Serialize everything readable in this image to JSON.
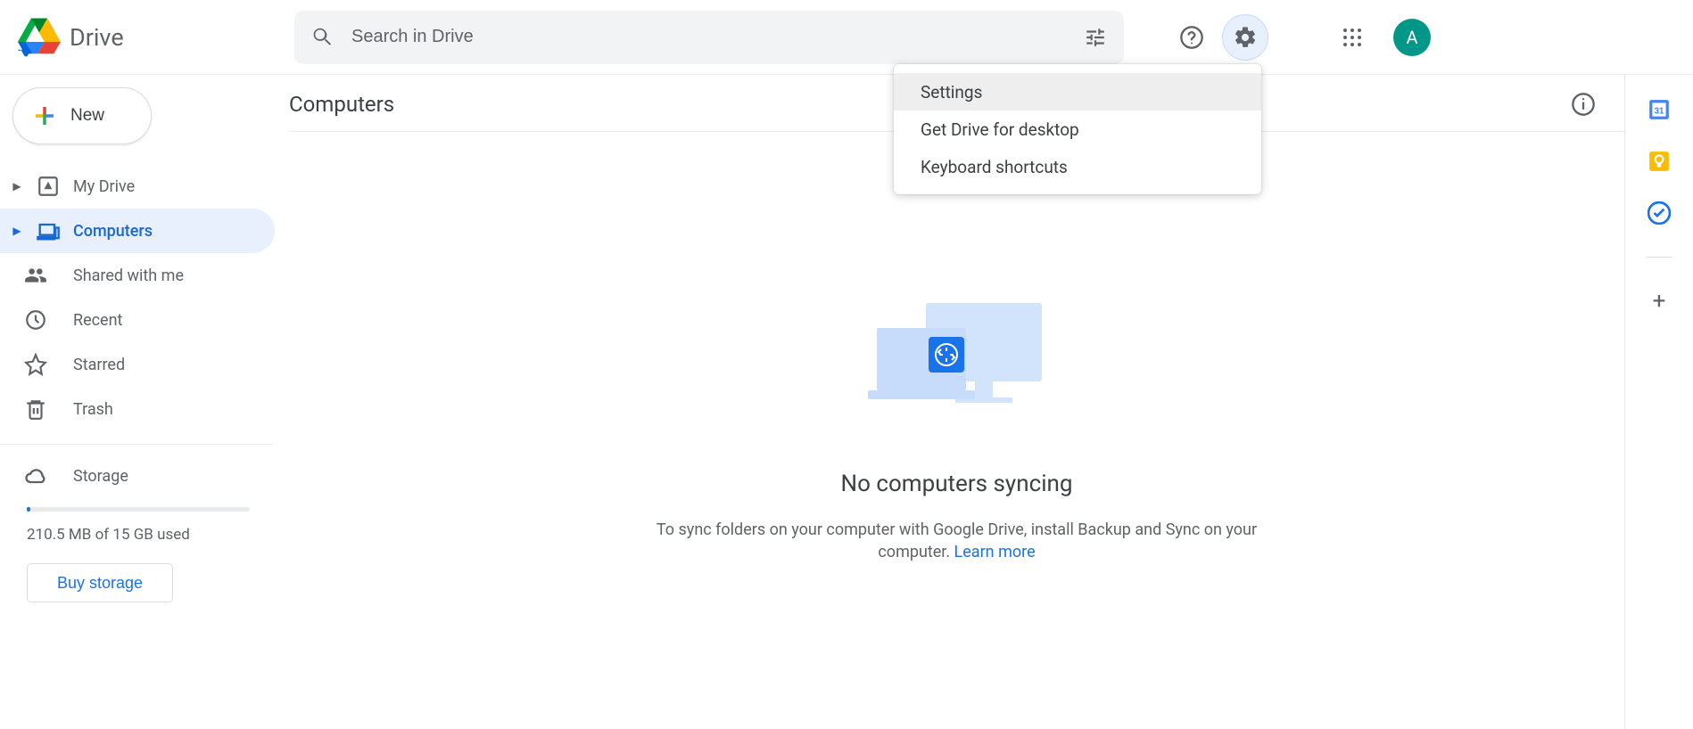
{
  "header": {
    "product_name": "Drive",
    "search_placeholder": "Search in Drive",
    "avatar_initial": "A"
  },
  "sidebar": {
    "new_label": "New",
    "items": [
      {
        "label": "My Drive"
      },
      {
        "label": "Computers"
      },
      {
        "label": "Shared with me"
      },
      {
        "label": "Recent"
      },
      {
        "label": "Starred"
      },
      {
        "label": "Trash"
      }
    ],
    "storage_label": "Storage",
    "storage_usage": "210.5 MB of 15 GB used",
    "buy_storage_label": "Buy storage"
  },
  "main": {
    "title": "Computers",
    "empty_title": "No computers syncing",
    "empty_desc_1": "To sync folders on your computer with Google Drive, install Backup and Sync on your computer. ",
    "learn_more": "Learn more"
  },
  "dropdown": {
    "items": [
      {
        "label": "Settings"
      },
      {
        "label": "Get Drive for desktop"
      },
      {
        "label": "Keyboard shortcuts"
      }
    ]
  }
}
